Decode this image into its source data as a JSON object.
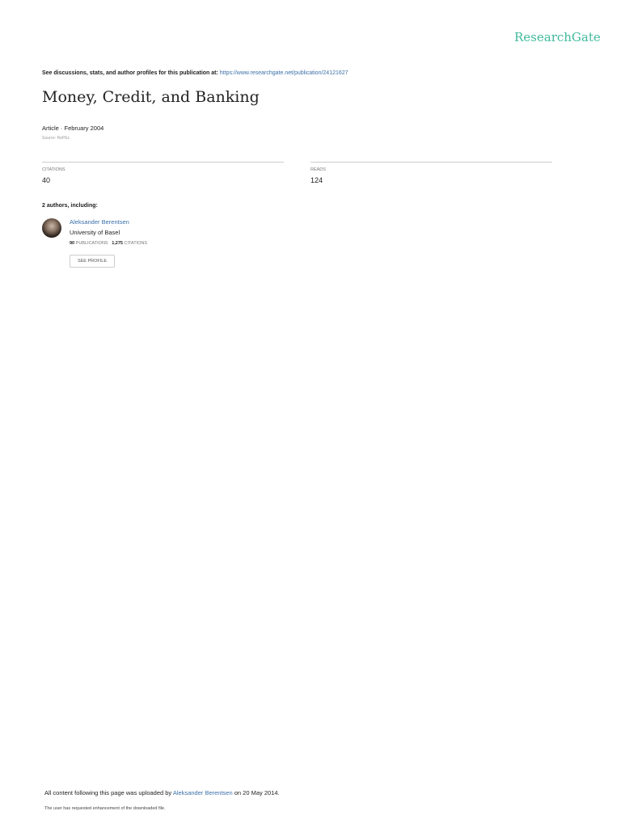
{
  "logo": "ResearchGate",
  "header": {
    "prefix": "See discussions, stats, and author profiles for this publication at:",
    "url": "https://www.researchgate.net/publication/24121627"
  },
  "title": "Money, Credit, and Banking",
  "meta": "Article · February 2004",
  "source": "Source: RePEc",
  "citations": {
    "label": "CITATIONS",
    "value": "40"
  },
  "reads": {
    "label": "READS",
    "value": "124"
  },
  "authors_heading": "2 authors, including:",
  "author": {
    "name": "Aleksander Berentsen",
    "institution": "University of Basel",
    "publications": "90",
    "publications_label": "PUBLICATIONS",
    "citations": "1,275",
    "citations_label": "CITATIONS",
    "button": "SEE PROFILE"
  },
  "footer": {
    "prefix": "All content following this page was uploaded by",
    "uploader": "Aleksander Berentsen",
    "suffix": "on 20 May 2014.",
    "note": "The user has requested enhancement of the downloaded file."
  }
}
